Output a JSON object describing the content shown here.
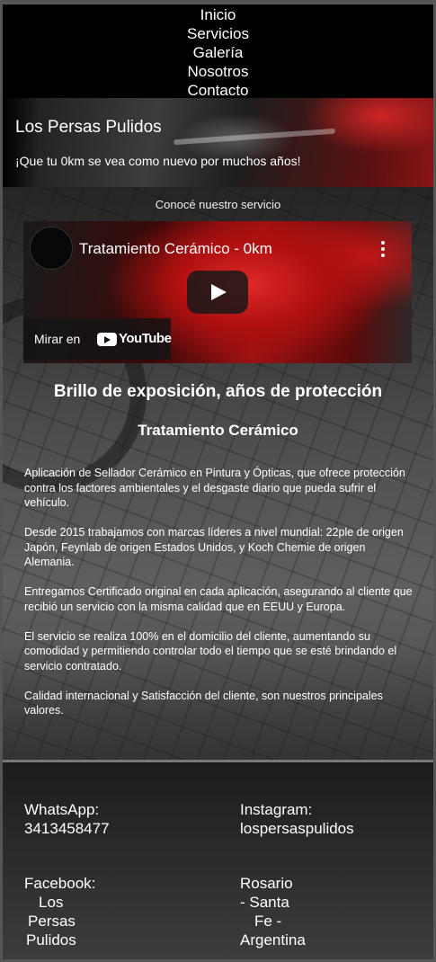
{
  "nav": {
    "items": [
      "Inicio",
      "Servicios",
      "Galería",
      "Nosotros",
      "Contacto"
    ]
  },
  "hero": {
    "title": "Los Persas Pulidos",
    "subtitle": "¡Que tu 0km se vea como nuevo por muchos años!"
  },
  "main": {
    "intro": "Conocé nuestro servicio",
    "video": {
      "title": "Tratamiento Cerámico - 0km",
      "watch_label": "Mirar en",
      "youtube_label": "YouTube"
    },
    "tagline": "Brillo de exposición, años de protección",
    "subheading": "Tratamiento Cerámico",
    "paragraphs": [
      "Aplicación de Sellador Cerámico en Pintura y Ópticas, que ofrece protección contra los factores ambientales y el desgaste diario que pueda sufrir el vehículo.",
      "Desde 2015 trabajamos con marcas líderes a nivel mundial: 22ple de origen Japón, Feynlab de origen Estados Unidos, y Koch Chemie de origen Alemania.",
      "Entregamos Certificado original en cada aplicación, asegurando al cliente que recibió un servicio con la misma calidad que en EEUU y Europa.",
      "El servicio se realiza 100% en el domicilio del cliente, aumentando su comodidad y permitiendo controlar todo el tiempo que se esté brindando el servicio contratado.",
      "Calidad internacional y Satisfacción del cliente, son nuestros principales valores."
    ]
  },
  "footer": {
    "whatsapp_label": "WhatsApp:",
    "whatsapp_value": "3413458477",
    "instagram_label": "Instagram:",
    "instagram_value": "lospersaspulidos",
    "facebook_label": "Facebook:",
    "facebook_lines": [
      "Los",
      "Persas",
      "Pulidos"
    ],
    "location_lines": [
      "Rosario",
      "- Santa",
      "Fe -",
      "Argentina"
    ]
  }
}
